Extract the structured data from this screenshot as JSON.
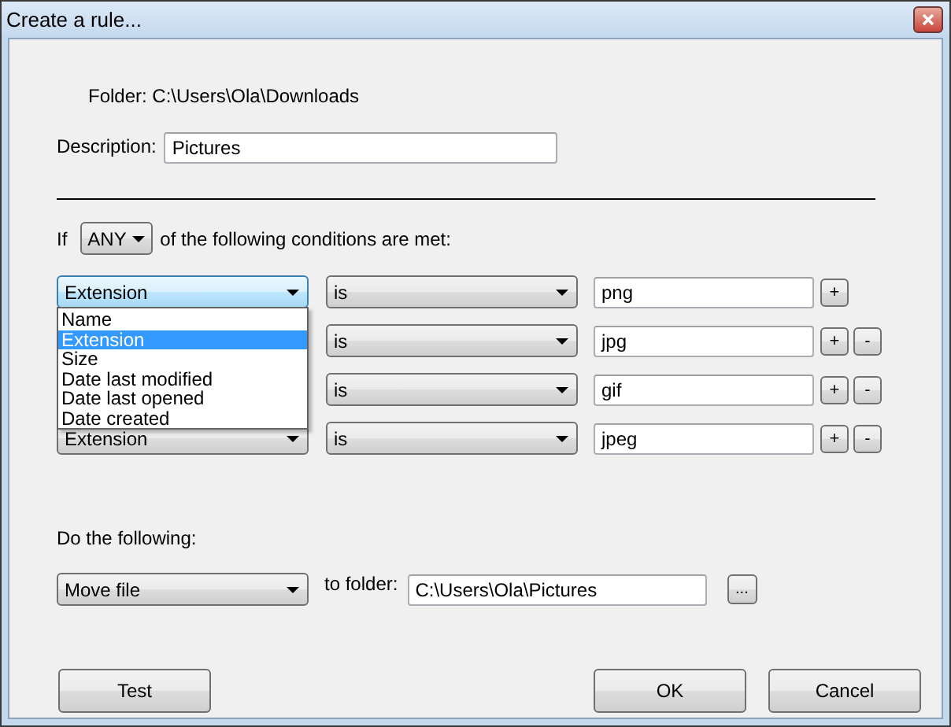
{
  "window": {
    "title": "Create a rule..."
  },
  "folder_label": "Folder: C:\\Users\\Ola\\Downloads",
  "description": {
    "label": "Description:",
    "value": "Pictures"
  },
  "match": {
    "prefix": "If",
    "value": "ANY",
    "suffix": "of the following conditions are met:"
  },
  "conditions": [
    {
      "field": "Extension",
      "expanded": true,
      "options": [
        {
          "label": "Name",
          "selected": false
        },
        {
          "label": "Extension",
          "selected": true
        },
        {
          "label": "Size",
          "selected": false
        },
        {
          "label": "Date last modified",
          "selected": false
        },
        {
          "label": "Date last opened",
          "selected": false
        },
        {
          "label": "Date created",
          "selected": false
        }
      ],
      "operator": "is",
      "value": "png",
      "buttons": [
        "+"
      ]
    },
    {
      "expanded": false,
      "operator": "is",
      "value": "jpg",
      "buttons": [
        "+",
        "-"
      ]
    },
    {
      "expanded": false,
      "operator": "is",
      "value": "gif",
      "buttons": [
        "+",
        "-"
      ]
    },
    {
      "field": "Extension",
      "expanded": false,
      "operator": "is",
      "value": "jpeg",
      "buttons": [
        "+",
        "-"
      ]
    }
  ],
  "action": {
    "label": "Do the following:",
    "value": "Move file",
    "folder_label": "to folder:",
    "folder": "C:\\Users\\Ola\\Pictures",
    "browse": "..."
  },
  "buttons": [
    {
      "label": "Test"
    },
    {
      "label": "OK"
    },
    {
      "label": "Cancel"
    }
  ]
}
